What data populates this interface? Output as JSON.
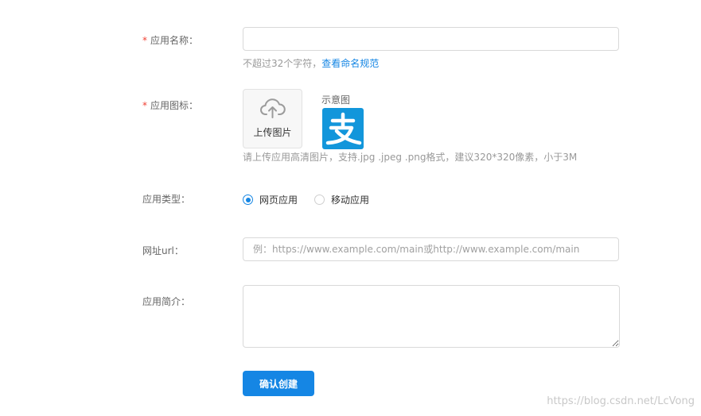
{
  "form": {
    "name": {
      "required_mark": "*",
      "label": "应用名称：",
      "value": "",
      "hint_text": "不超过32个字符，",
      "hint_link": "查看命名规范"
    },
    "icon": {
      "required_mark": "*",
      "label": "应用图标：",
      "upload_label": "上传图片",
      "upload_icon": "cloud-upload-icon",
      "sample_title": "示意图",
      "sample_icon": "alipay-logo",
      "hint": "请上传应用高清图片，支持.jpg .jpeg .png格式，建议320*320像素，小于3M"
    },
    "type": {
      "label": "应用类型：",
      "options": [
        {
          "label": "网页应用",
          "checked": true
        },
        {
          "label": "移动应用",
          "checked": false
        }
      ]
    },
    "url": {
      "label": "网址url：",
      "value": "",
      "placeholder": "例：https://www.example.com/main或http://www.example.com/main"
    },
    "intro": {
      "label": "应用简介：",
      "value": ""
    },
    "submit_label": "确认创建"
  },
  "watermark": "https://blog.csdn.net/LcVong",
  "colors": {
    "primary": "#1586e4",
    "required": "#f04134",
    "alipay_blue": "#1296db"
  }
}
